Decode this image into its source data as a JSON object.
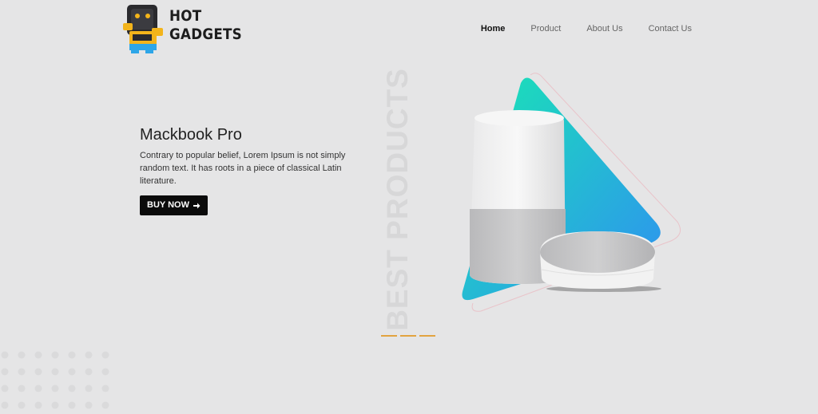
{
  "brand": {
    "line1": "HOT",
    "line2": "GADGETS",
    "logo_icon": "robot-logo-icon"
  },
  "nav": {
    "items": [
      "Home",
      "Product",
      "About Us",
      "Contact Us"
    ],
    "active": "Home"
  },
  "hero": {
    "title": "Mackbook Pro",
    "text": "Contrary to popular belief, Lorem Ipsum is not simply random text. It has roots in a piece of classical Latin literature.",
    "button_label": "BUY NOW",
    "button_icon": "arrow-right-icon"
  },
  "vertical_text": "BEST PRODUCTS",
  "slider": {
    "count": 3,
    "active_index": 0
  },
  "colors": {
    "accent": "#e2a340",
    "button": "#0b0b0b",
    "gradient_start": "#19e6b4",
    "gradient_end": "#2f8ff2"
  }
}
